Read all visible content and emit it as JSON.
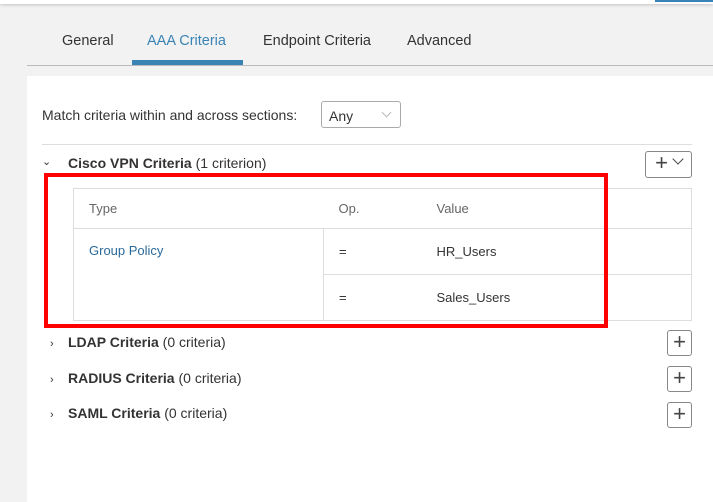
{
  "tabs": [
    {
      "label": "General"
    },
    {
      "label": "AAA Criteria",
      "active": true
    },
    {
      "label": "Endpoint Criteria"
    },
    {
      "label": "Advanced"
    }
  ],
  "match": {
    "label": "Match criteria within and across sections:",
    "value": "Any"
  },
  "sections": [
    {
      "title": "Cisco VPN Criteria",
      "count": "(1 criterion)",
      "expanded": true
    },
    {
      "title": "LDAP Criteria",
      "count": "(0 criteria)"
    },
    {
      "title": "RADIUS Criteria",
      "count": "(0 criteria)"
    },
    {
      "title": "SAML Criteria",
      "count": "(0 criteria)"
    }
  ],
  "table": {
    "headers": [
      "Type",
      "Op.",
      "Value"
    ],
    "type": "Group Policy",
    "rows": [
      {
        "op": "=",
        "value": "HR_Users"
      },
      {
        "op": "=",
        "value": "Sales_Users"
      }
    ]
  },
  "icons": {
    "add": "+",
    "expanded": "⌄",
    "collapsed": "›"
  },
  "colors": {
    "accent": "#3a84b5",
    "highlight": "#ff0000"
  }
}
